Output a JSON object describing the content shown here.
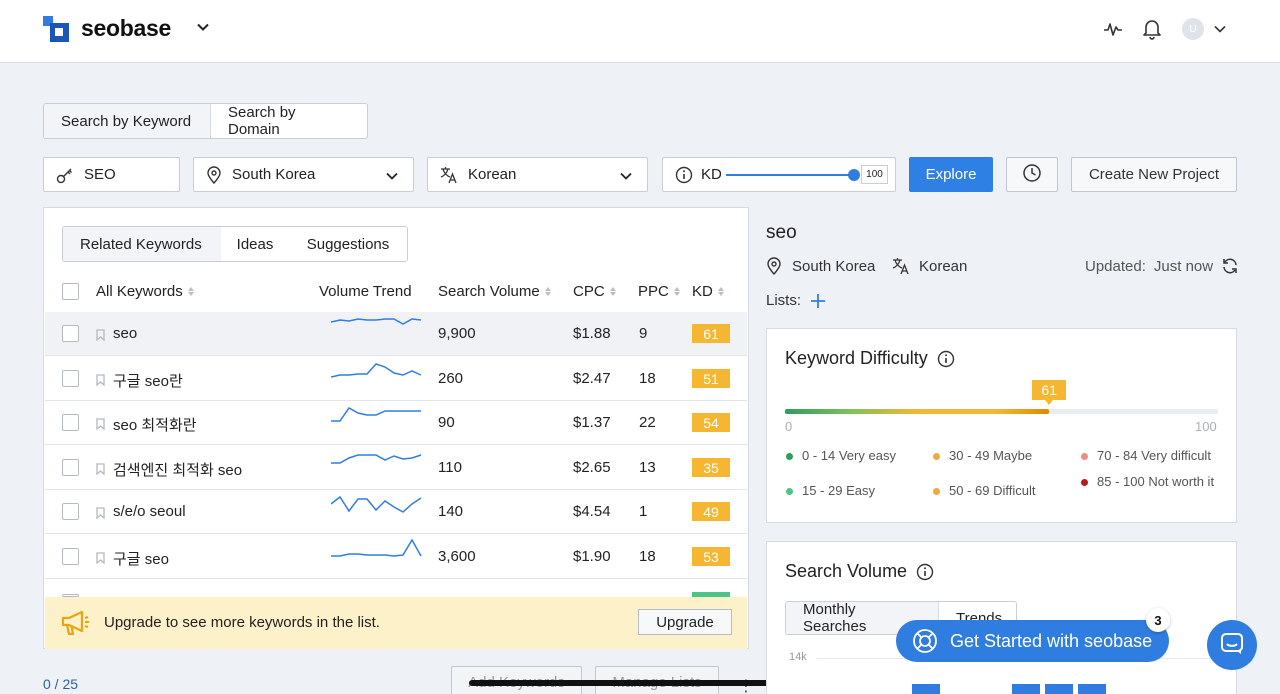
{
  "header": {
    "brand": "seobase",
    "avatar_initial": "U"
  },
  "search_mode": {
    "options": [
      "Search by Keyword",
      "Search by Domain"
    ]
  },
  "filters": {
    "keyword": "SEO",
    "country": "South Korea",
    "language": "Korean",
    "kd_label": "KD",
    "kd_value": "100",
    "explore_label": "Explore",
    "create_project_label": "Create New Project"
  },
  "keyword_tabs": [
    "Related Keywords",
    "Ideas",
    "Suggestions"
  ],
  "table": {
    "headers": {
      "keyword": "All Keywords",
      "trend": "Volume Trend",
      "volume": "Search Volume",
      "cpc": "CPC",
      "ppc": "PPC",
      "kd": "KD"
    },
    "rows": [
      {
        "keyword": "seo",
        "volume": "9,900",
        "cpc": "$1.88",
        "ppc": "9",
        "kd": "61",
        "trend": [
          6,
          4,
          5,
          3,
          4,
          4,
          3,
          3,
          8,
          3,
          4
        ]
      },
      {
        "keyword": "구글 seo란",
        "volume": "260",
        "cpc": "$2.47",
        "ppc": "18",
        "kd": "51",
        "trend": [
          16,
          14,
          14,
          13,
          13,
          3,
          6,
          12,
          14,
          10,
          14
        ]
      },
      {
        "keyword": "seo 최적화란",
        "volume": "90",
        "cpc": "$1.37",
        "ppc": "22",
        "kd": "54",
        "trend": [
          16,
          16,
          3,
          8,
          10,
          10,
          6,
          6,
          6,
          6,
          6
        ]
      },
      {
        "keyword": "검색엔진 최적화 seo",
        "volume": "110",
        "cpc": "$2.65",
        "ppc": "13",
        "kd": "35",
        "trend": [
          13,
          13,
          8,
          5,
          5,
          5,
          10,
          6,
          9,
          8,
          5
        ]
      },
      {
        "keyword": "s/e/o seoul",
        "volume": "140",
        "cpc": "$4.54",
        "ppc": "1",
        "kd": "49",
        "trend": [
          10,
          3,
          17,
          5,
          5,
          16,
          7,
          13,
          18,
          10,
          4
        ]
      },
      {
        "keyword": "구글 seo",
        "volume": "3,600",
        "cpc": "$1.90",
        "ppc": "18",
        "kd": "53",
        "trend": [
          17,
          17,
          15,
          15,
          16,
          16,
          16,
          17,
          16,
          1,
          17
        ]
      }
    ],
    "counter": "0 / 25",
    "add_keywords_label": "Add Keywords",
    "manage_lists_label": "Manage Lists"
  },
  "upgrade": {
    "text": "Upgrade to see more keywords in the list.",
    "button": "Upgrade"
  },
  "detail": {
    "keyword": "seo",
    "country": "South Korea",
    "language": "Korean",
    "updated_label": "Updated:",
    "updated_value": "Just now",
    "lists_label": "Lists:"
  },
  "difficulty": {
    "title": "Keyword Difficulty",
    "value": "61",
    "fraction": 0.61,
    "min": "0",
    "max": "100",
    "legend": [
      {
        "label": "0 - 14 Very easy",
        "color": "#2e9e5b"
      },
      {
        "label": "30 - 49 Maybe",
        "color": "#f2a93b"
      },
      {
        "label": "70 - 84 Very difficult",
        "color": "#f28b82"
      },
      {
        "label": "15 - 29 Easy",
        "color": "#4cc38a"
      },
      {
        "label": "50 - 69 Difficult",
        "color": "#f2a93b"
      },
      {
        "label": "85 - 100 Not worth it",
        "color": "#b71c1c"
      }
    ]
  },
  "search_volume": {
    "title": "Search Volume",
    "tabs": [
      "Monthly Searches",
      "Trends"
    ],
    "y_tick": "14k"
  },
  "chat": {
    "label": "Get Started with seobase",
    "badge": "3"
  },
  "colors": {
    "primary": "#2f80e4",
    "kd_badge": "#f5b731",
    "upgrade_bg": "#fdf1c9"
  }
}
